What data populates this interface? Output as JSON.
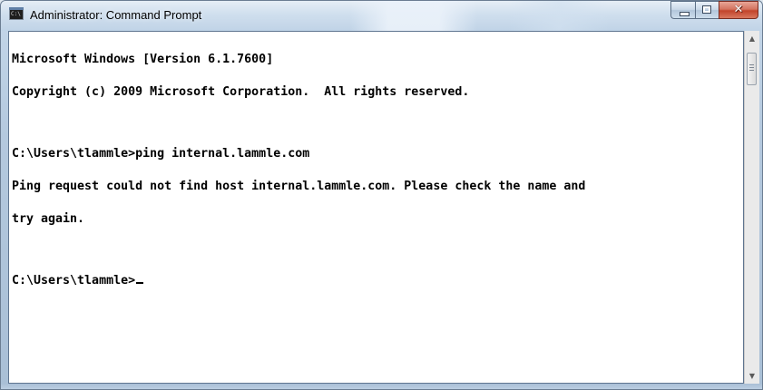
{
  "window": {
    "title": "Administrator: Command Prompt",
    "icon": "cmd-icon",
    "buttons": {
      "minimize_icon": "minimize-icon",
      "maximize_icon": "maximize-icon",
      "close_icon": "close-icon",
      "close_glyph": "✕"
    }
  },
  "console": {
    "lines": [
      "Microsoft Windows [Version 6.1.7600]",
      "Copyright (c) 2009 Microsoft Corporation.  All rights reserved.",
      "",
      "C:\\Users\\tlammle>ping internal.lammle.com",
      "Ping request could not find host internal.lammle.com. Please check the name and",
      "try again.",
      "",
      "C:\\Users\\tlammle>"
    ],
    "text_color": "#000000",
    "background": "#ffffff"
  },
  "scrollbar": {
    "up_arrow": "▲",
    "down_arrow": "▼"
  },
  "colors": {
    "titlebar": "#c6d8ea",
    "close_button": "#c2442b"
  }
}
